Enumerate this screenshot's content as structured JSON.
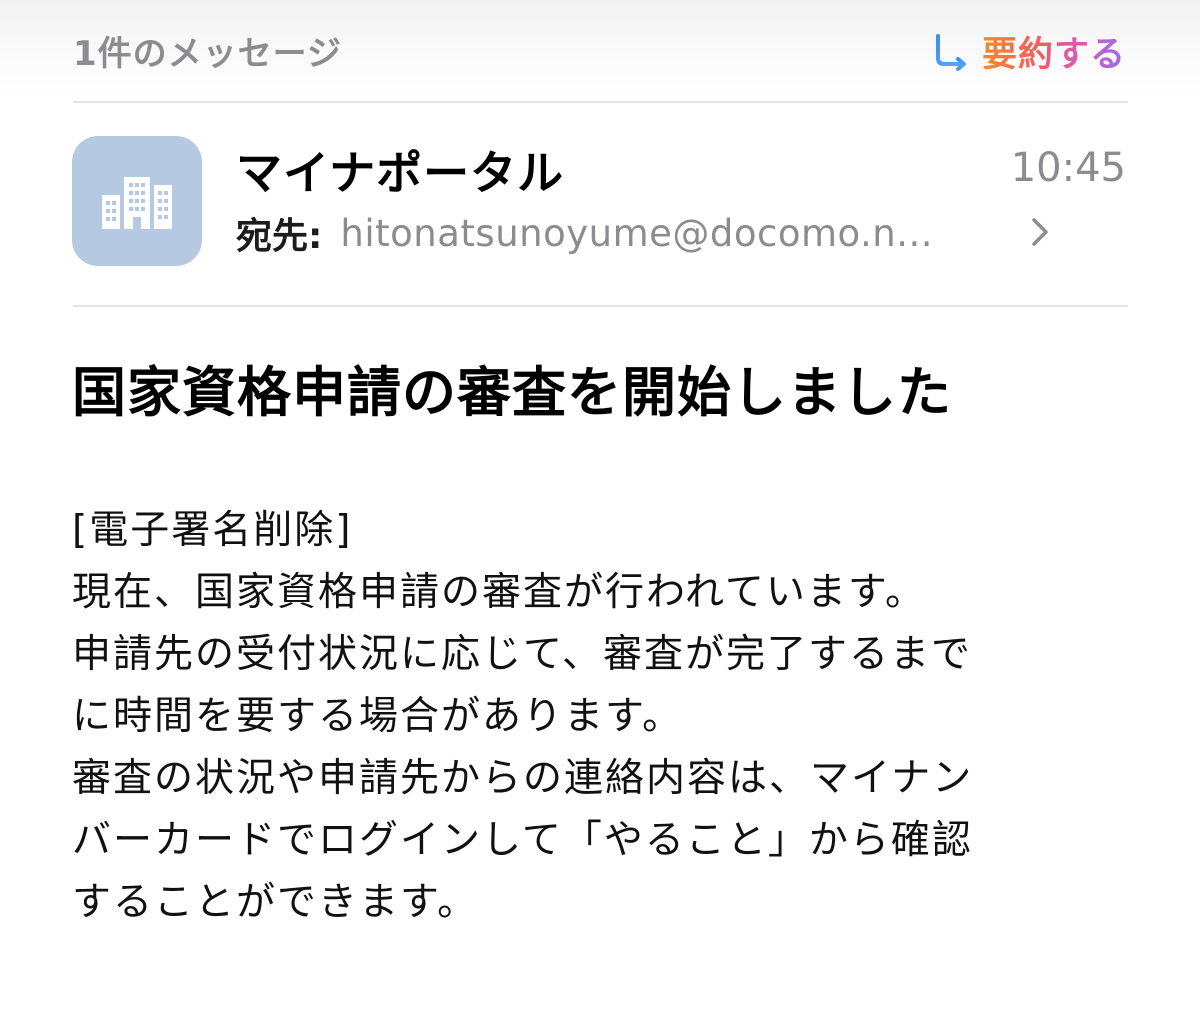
{
  "header": {
    "message_count": "1件のメッセージ",
    "summarize_label": "要約する",
    "summarize_icon": "summarize-icon"
  },
  "sender": {
    "avatar_icon": "building-icon",
    "avatar_color": "#b5c9e3",
    "name": "マイナポータル",
    "time": "10:45",
    "to_label": "宛先:",
    "to_value": "hitonatsunoyume@docomo.n..."
  },
  "message": {
    "subject": "国家資格申請の審査を開始しました",
    "body_lines": [
      "[電子署名削除]",
      "現在、国家資格申請の審査が行われています。",
      "申請先の受付状況に応じて、審査が完了するまで",
      "に時間を要する場合があります。",
      "審査の状況や申請先からの連絡内容は、マイナン",
      "バーカードでログインして「やること」から確認",
      "することができます。"
    ]
  },
  "colors": {
    "muted_text": "#8c8c90",
    "summarize_gradient": [
      "#f58a2a",
      "#f0605d",
      "#d75ab4",
      "#9a6bf0"
    ],
    "divider": "#e4e4e6"
  }
}
